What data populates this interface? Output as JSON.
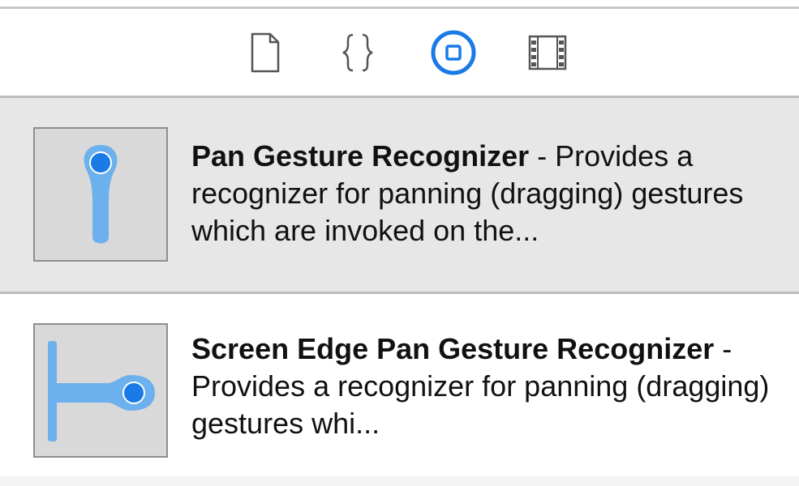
{
  "toolbar": {
    "tabs": [
      {
        "icon": "file-icon",
        "label": "File Template Library",
        "selected": false
      },
      {
        "icon": "code-braces-icon",
        "label": "Code Snippet Library",
        "selected": false
      },
      {
        "icon": "object-library-icon",
        "label": "Object Library",
        "selected": true
      },
      {
        "icon": "media-library-icon",
        "label": "Media Library",
        "selected": false
      }
    ],
    "accent_color": "#1a7ae6",
    "icon_color": "#555555"
  },
  "library": {
    "items": [
      {
        "icon": "pan-gesture-icon",
        "name": "Pan Gesture Recognizer",
        "separator": " - ",
        "description": "Provides a recognizer for panning (dragging) gestures which are invoked on the...",
        "selected": true
      },
      {
        "icon": "screen-edge-pan-gesture-icon",
        "name": "Screen Edge Pan Gesture Recognizer",
        "separator": " - ",
        "description": "Provides a recognizer for panning (dragging) gestures whi...",
        "selected": false
      }
    ]
  }
}
